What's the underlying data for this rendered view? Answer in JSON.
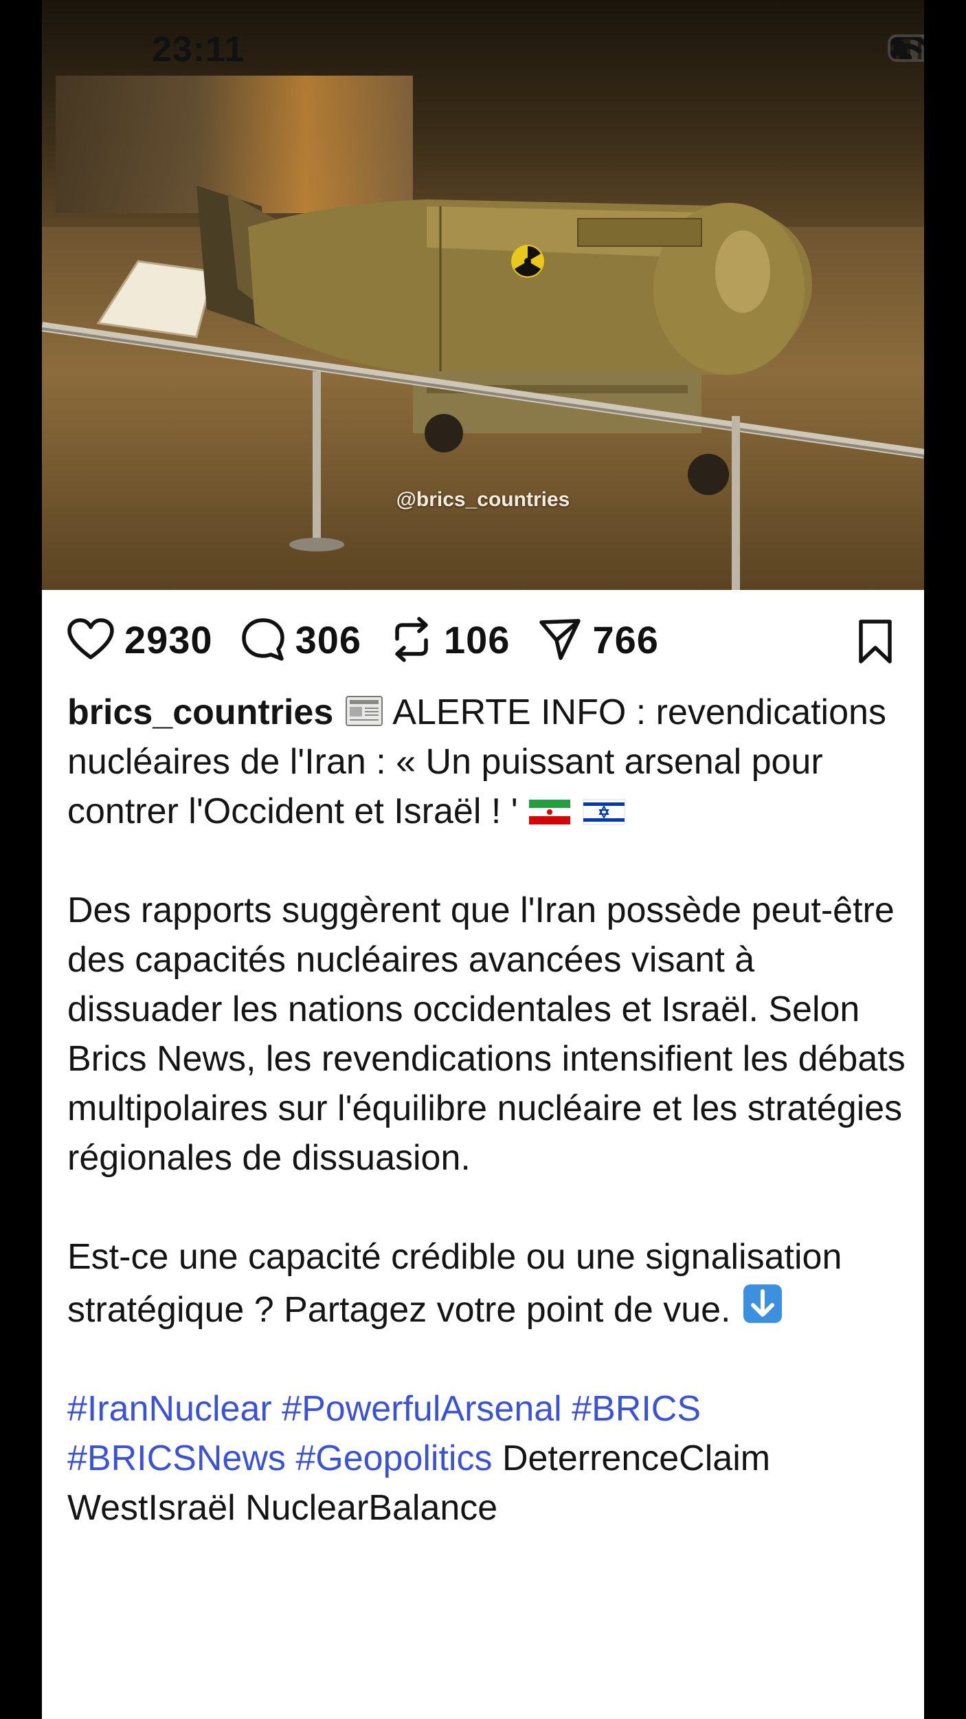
{
  "status_bar": {
    "time": "23:11"
  },
  "photo": {
    "watermark": "@brics_countries"
  },
  "actions": {
    "likes": "2930",
    "comments": "306",
    "reposts": "106",
    "shares": "766"
  },
  "post": {
    "username": "brics_countries",
    "headline": "ALERTE INFO : revendications nucléaires de l'Iran : « Un puissant arsenal pour contrer l'Occident et Israël ! '",
    "paragraph1": "Des rapports suggèrent que l'Iran possède peut-être des capacités nucléaires avancées visant à dissuader les nations occidentales et Israël. Selon Brics News, les revendications intensifient les débats multipolaires sur l'équilibre nucléaire et les stratégies régionales de dissuasion.",
    "paragraph2": "Est-ce une capacité crédible ou une signalisation stratégique ? Partagez votre point de vue.",
    "hashtags": [
      "#IranNuclear",
      "#PowerfulArsenal",
      "#BRICS",
      "#BRICSNews",
      "#Geopolitics"
    ],
    "plain_tags": "DeterrenceClaim WestIsraël NuclearBalance"
  },
  "colors": {
    "hashtag": "#3a52d8",
    "text": "#141414"
  },
  "icons": [
    "heart-icon",
    "comment-icon",
    "repost-icon",
    "share-icon",
    "bookmark-icon",
    "newspaper-emoji",
    "iran-flag-emoji",
    "israel-flag-emoji",
    "down-arrow-emoji",
    "signal-icon",
    "wifi-icon",
    "battery-icon"
  ]
}
